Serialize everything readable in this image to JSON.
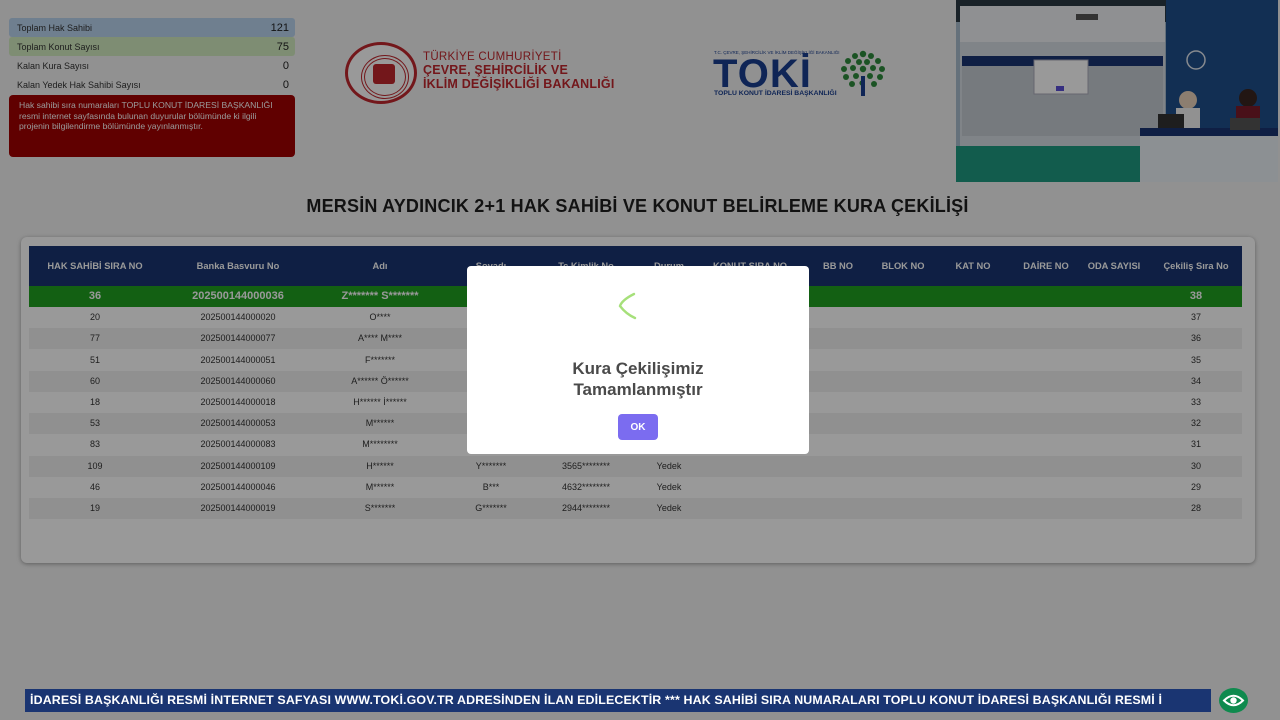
{
  "stats": [
    {
      "label": "Toplam Hak Sahibi",
      "value": "121"
    },
    {
      "label": "Toplam Konut Sayısı",
      "value": "75"
    },
    {
      "label": "Kalan Kura Sayısı",
      "value": "0"
    },
    {
      "label": "Kalan Yedek Hak Sahibi Sayısı",
      "value": "0"
    }
  ],
  "notice": "Hak sahibi sıra numaraları TOPLU KONUT İDARESİ BAŞKANLIĞI resmi internet sayfasında bulunan duyurular bölümünde ki ilgili projenin bilgilendirme bölümünde yayınlanmıştır.",
  "ministry": {
    "line0": "TÜRKİYE CUMHURİYETİ",
    "line1": "ÇEVRE, ŞEHİRCİLİK VE",
    "line2": "İKLİM DEĞİŞİKLİĞİ BAKANLIĞI"
  },
  "toki": {
    "small": "T.C. ÇEVRE, ŞEHİRCİLİK VE İKLİM DEĞİŞİKLİĞİ BAKANLIĞI",
    "word": "TOKİ",
    "sub": "TOPLU KONUT İDARESİ BAŞKANLIĞI"
  },
  "title": "MERSİN AYDINCIK 2+1 HAK SAHİBİ VE KONUT BELİRLEME KURA ÇEKİLİŞİ",
  "table": {
    "headers": [
      "HAK SAHİBİ SIRA NO",
      "Banka Basvuru No",
      "Adı",
      "Soyadı",
      "Tc Kimlik No",
      "Durum",
      "KONUT SIRA NO",
      "BB NO",
      "BLOK NO",
      "KAT NO",
      "DAİRE NO",
      "ODA SAYISI",
      "Çekiliş Sıra No"
    ],
    "rows": [
      [
        "36",
        "202500144000036",
        "Z******* S*******",
        "",
        "",
        "",
        "",
        "",
        "",
        "",
        "",
        "",
        "38"
      ],
      [
        "20",
        "202500144000020",
        "O****",
        "",
        "",
        "",
        "",
        "",
        "",
        "",
        "",
        "",
        "37"
      ],
      [
        "77",
        "202500144000077",
        "A**** M****",
        "",
        "",
        "",
        "",
        "",
        "",
        "",
        "",
        "",
        "36"
      ],
      [
        "51",
        "202500144000051",
        "F*******",
        "",
        "",
        "",
        "",
        "",
        "",
        "",
        "",
        "",
        "35"
      ],
      [
        "60",
        "202500144000060",
        "A****** Ö******",
        "",
        "",
        "",
        "",
        "",
        "",
        "",
        "",
        "",
        "34"
      ],
      [
        "18",
        "202500144000018",
        "H****** İ******",
        "",
        "",
        "",
        "",
        "",
        "",
        "",
        "",
        "",
        "33"
      ],
      [
        "53",
        "202500144000053",
        "M******",
        "",
        "",
        "",
        "",
        "",
        "",
        "",
        "",
        "",
        "32"
      ],
      [
        "83",
        "202500144000083",
        "M********",
        "",
        "",
        "",
        "",
        "",
        "",
        "",
        "",
        "",
        "31"
      ],
      [
        "109",
        "202500144000109",
        "H******",
        "Y*******",
        "3565********",
        "Yedek",
        "",
        "",
        "",
        "",
        "",
        "",
        "30"
      ],
      [
        "46",
        "202500144000046",
        "M******",
        "B***",
        "4632********",
        "Yedek",
        "",
        "",
        "",
        "",
        "",
        "",
        "29"
      ],
      [
        "19",
        "202500144000019",
        "S*******",
        "G*******",
        "2944********",
        "Yedek",
        "",
        "",
        "",
        "",
        "",
        "",
        "28"
      ]
    ]
  },
  "modal": {
    "title_line1": "Kura Çekilişimiz",
    "title_line2": "Tamamlanmıştır",
    "ok_label": "OK"
  },
  "ticker": "İDARESİ BAŞKANLIĞI RESMİ İNTERNET SAFYASI WWW.TOKİ.GOV.TR ADRESİNDEN İLAN EDİLECEKTİR *** HAK SAHİBİ SIRA NUMARALARI TOPLU KONUT İDARESİ BAŞKANLIĞI RESMİ İ",
  "colors": {
    "header": "#1a3572",
    "winner_row": "#20a020",
    "notice": "#a10000",
    "ok_button": "#7b6cf0",
    "brand_red": "#c0272d"
  },
  "icons": {
    "modal": "loading-spinner-icon",
    "ticker_button": "eye-icon"
  }
}
